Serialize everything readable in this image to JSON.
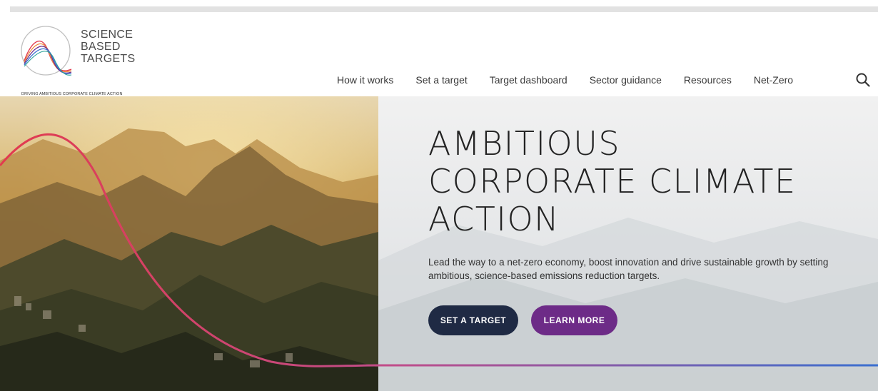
{
  "logo": {
    "lines": [
      "SCIENCE",
      "BASED",
      "TARGETS"
    ],
    "tagline": "DRIVING AMBITIOUS CORPORATE CLIMATE ACTION"
  },
  "nav": {
    "items": [
      "How it works",
      "Set a target",
      "Target dashboard",
      "Sector guidance",
      "Resources",
      "Net-Zero"
    ]
  },
  "icons": {
    "search": "search-icon",
    "logo": "sbti-logo-icon"
  },
  "hero": {
    "title_lines": [
      "AMBITIOUS",
      "CORPORATE CLIMATE",
      "ACTION"
    ],
    "subtitle": "Lead the way to a net-zero economy, boost innovation and drive sustainable growth by setting ambitious, science-based emissions reduction targets.",
    "primary_button": "SET A TARGET",
    "secondary_button": "LEARN MORE"
  },
  "colors": {
    "primary_button": "#1f2a44",
    "secondary_button": "#6d2b87",
    "curve_start": "#e23a4e",
    "curve_end": "#3a6fd0"
  }
}
